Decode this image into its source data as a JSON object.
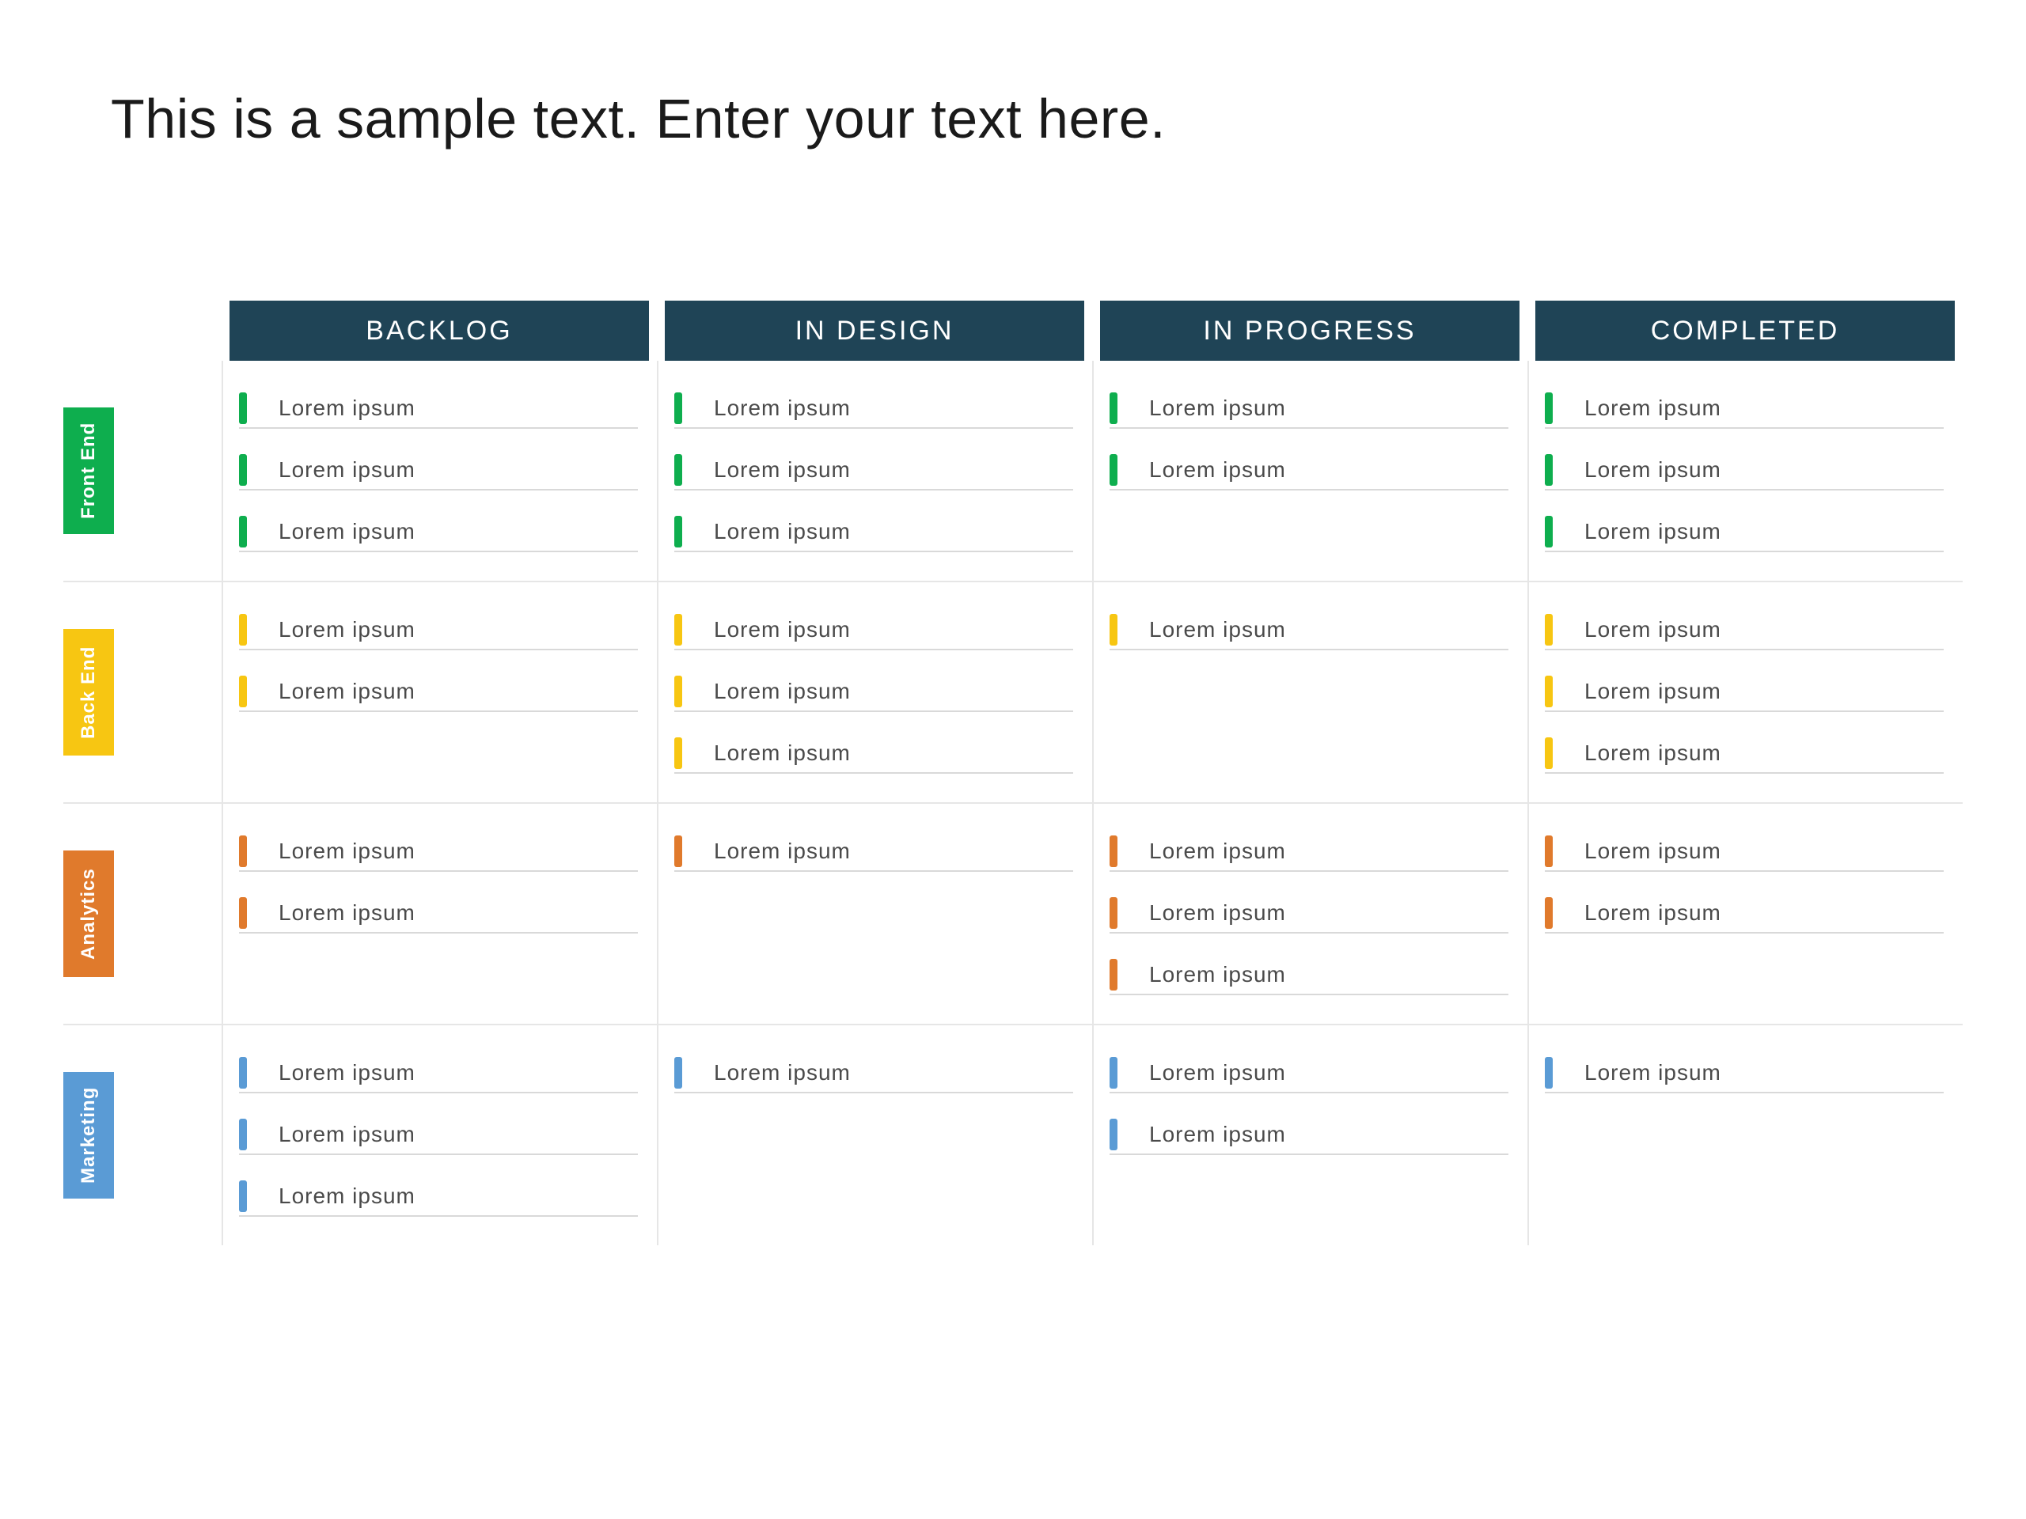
{
  "title": "This is a sample text. Enter your text here.",
  "columns": [
    "BACKLOG",
    "IN DESIGN",
    "IN PROGRESS",
    "COMPLETED"
  ],
  "rows": [
    {
      "label": "Front End",
      "color": "#0eae4e",
      "cells": [
        [
          "Lorem ipsum",
          "Lorem ipsum",
          "Lorem ipsum"
        ],
        [
          "Lorem ipsum",
          "Lorem ipsum",
          "Lorem ipsum"
        ],
        [
          "Lorem ipsum",
          "Lorem ipsum"
        ],
        [
          "Lorem ipsum",
          "Lorem ipsum",
          "Lorem ipsum"
        ]
      ]
    },
    {
      "label": "Back End",
      "color": "#f7c612",
      "cells": [
        [
          "Lorem ipsum",
          "Lorem ipsum"
        ],
        [
          "Lorem ipsum",
          "Lorem ipsum",
          "Lorem ipsum"
        ],
        [
          "Lorem ipsum"
        ],
        [
          "Lorem ipsum",
          "Lorem ipsum",
          "Lorem ipsum"
        ]
      ]
    },
    {
      "label": "Analytics",
      "color": "#e07a2c",
      "cells": [
        [
          "Lorem ipsum",
          "Lorem ipsum"
        ],
        [
          "Lorem ipsum"
        ],
        [
          "Lorem ipsum",
          "Lorem ipsum",
          "Lorem ipsum"
        ],
        [
          "Lorem ipsum",
          "Lorem ipsum"
        ]
      ]
    },
    {
      "label": "Marketing",
      "color": "#5a9bd5",
      "cells": [
        [
          "Lorem ipsum",
          "Lorem ipsum",
          "Lorem ipsum"
        ],
        [
          "Lorem ipsum"
        ],
        [
          "Lorem ipsum",
          "Lorem ipsum"
        ],
        [
          "Lorem ipsum"
        ]
      ]
    }
  ]
}
